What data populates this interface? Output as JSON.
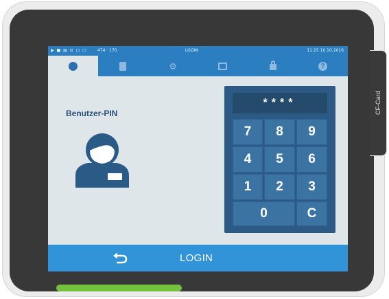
{
  "status_bar": {
    "icons": "▶ ■ ▤ ⊡ ▢ ▢",
    "coords": "474 · 170",
    "title": "LOGIN",
    "datetime": "11:25  10.10.2016"
  },
  "tabs": [
    {
      "icon": "login-icon",
      "active": true
    },
    {
      "icon": "document-icon",
      "active": false
    },
    {
      "icon": "settings-icon",
      "active": false
    },
    {
      "icon": "statistics-icon",
      "active": false
    },
    {
      "icon": "lock-icon",
      "active": false
    },
    {
      "icon": "help-icon",
      "active": false
    }
  ],
  "help_glyph": "?",
  "gear_glyph": "⚙",
  "login": {
    "pin_label": "Benutzer-PIN",
    "pin_value": "****"
  },
  "keypad": {
    "keys": [
      "7",
      "8",
      "9",
      "4",
      "5",
      "6",
      "1",
      "2",
      "3",
      "0",
      "C"
    ]
  },
  "bottom_bar": {
    "title": "LOGIN",
    "back_icon": "back-arrow-icon"
  },
  "device": {
    "cf_label": "CF-Card"
  },
  "colors": {
    "accent": "#2b7fc1",
    "bottom_bar": "#3294d8",
    "keypad": "#2d5a84",
    "key": "#3b73a3",
    "led": "#74c13e"
  }
}
